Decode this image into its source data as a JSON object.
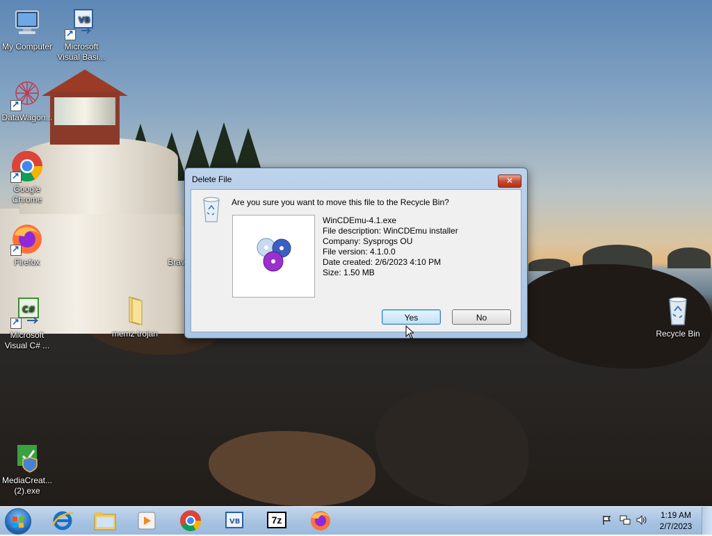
{
  "desktop_icons": [
    {
      "id": "my-computer",
      "label": "My Computer"
    },
    {
      "id": "visual-basic",
      "label": "Microsoft Visual Basi..."
    },
    {
      "id": "datawagon",
      "label": "DataWagon..."
    },
    {
      "id": "google-chrome",
      "label": "Google Chrome"
    },
    {
      "id": "firefox",
      "label": "Firefox"
    },
    {
      "id": "brave",
      "label": "Brave"
    },
    {
      "id": "visual-csharp",
      "label": "Microsoft Visual C# ..."
    },
    {
      "id": "memz-trojan",
      "label": "memz trojan"
    },
    {
      "id": "recycle-bin",
      "label": "Recycle Bin"
    },
    {
      "id": "media-creation",
      "label": "MediaCreat... (2).exe"
    }
  ],
  "dialog": {
    "title": "Delete File",
    "close_label": "✕",
    "question": "Are you sure you want to move this file to the Recycle Bin?",
    "file_name": "WinCDEmu-4.1.exe",
    "description": "File description: WinCDEmu installer",
    "company": "Company: Sysprogs OU",
    "version": "File version: 4.1.0.0",
    "created": "Date created: 2/6/2023 4:10 PM",
    "size": "Size: 1.50 MB",
    "yes_label": "Yes",
    "no_label": "No"
  },
  "taskbar": {
    "items": [
      "start-orb",
      "internet-explorer",
      "file-explorer",
      "media-player",
      "google-chrome",
      "visual-basic",
      "7-zip",
      "firefox"
    ],
    "seven_zip_label": "7z",
    "time": "1:19 AM",
    "date": "2/7/2023"
  },
  "colors": {
    "accent": "#3c7fb1",
    "taskbar": "#a9c4e2",
    "close_button": "#c7472e"
  }
}
